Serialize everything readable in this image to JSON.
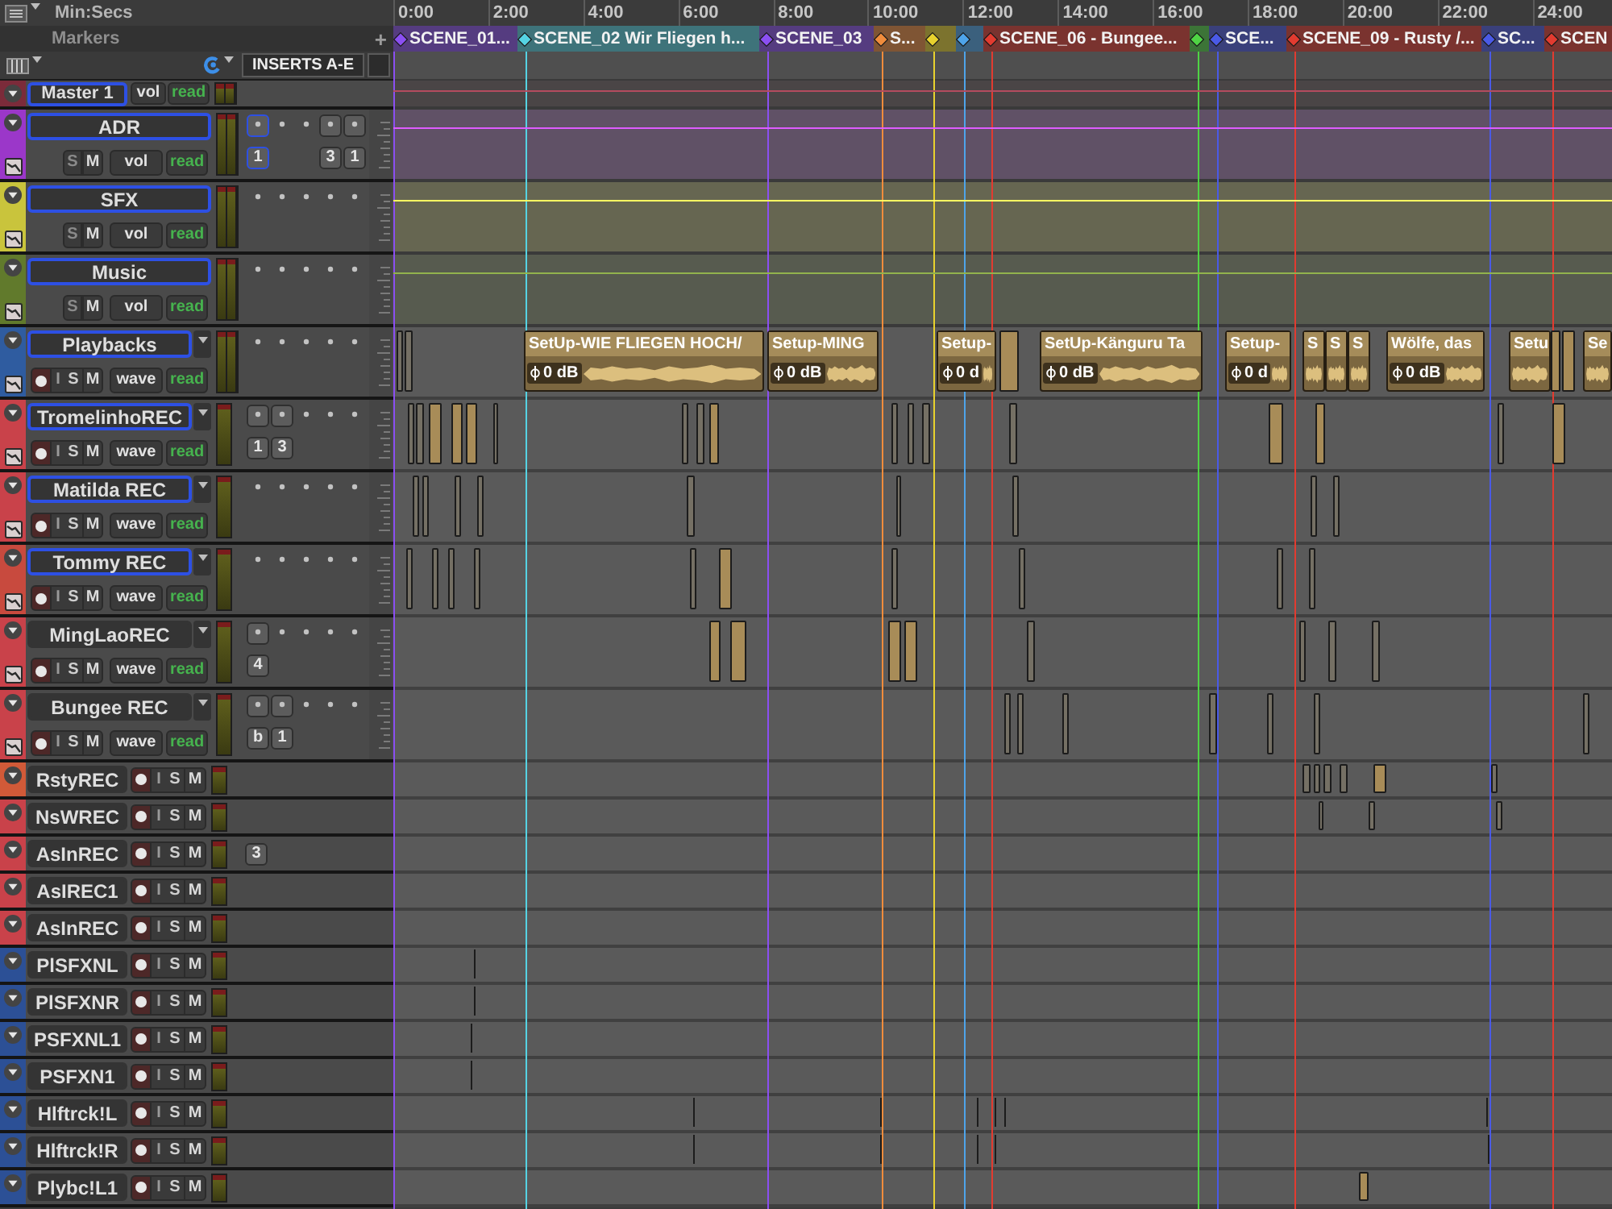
{
  "ruler": {
    "label": "Min:Secs",
    "ticks": [
      "0:00",
      "2:00",
      "4:00",
      "6:00",
      "8:00",
      "10:00",
      "12:00",
      "14:00",
      "16:00",
      "18:00",
      "20:00",
      "22:00",
      "24:00"
    ]
  },
  "markers": {
    "label": "Markers",
    "add": "+",
    "items": [
      {
        "name": "SCENE_01...",
        "color": "#8b4ff2"
      },
      {
        "name": "SCENE_02 Wir Fliegen h...",
        "color": "#55d3e3"
      },
      {
        "name": "SCENE_03",
        "color": "#8b4ff2"
      },
      {
        "name": "S...",
        "color": "#f08c3c"
      },
      {
        "color": "#e8d22e"
      },
      {
        "color": "#4ea4ea"
      },
      {
        "name": "SCENE_06 - Bungee...",
        "color": "#e23b30"
      },
      {
        "color": "#4fd444"
      },
      {
        "name": "SCE...",
        "color": "#4a5ae6"
      },
      {
        "name": "SCENE_09 - Rusty /...",
        "color": "#e23b30"
      },
      {
        "name": "SC...",
        "color": "#4a5ae6"
      },
      {
        "name": "SCEN",
        "color": "#e23b30"
      }
    ]
  },
  "track_list": {
    "column": "INSERTS A-E"
  },
  "tracks": [
    {
      "name": "Master 1",
      "color": "#7b2b3a",
      "kind": "master",
      "selected": true,
      "stereo": true,
      "view": "vol",
      "automation": "read"
    },
    {
      "name": "ADR",
      "color": "#9b37c9",
      "kind": "aux",
      "selected": true,
      "stereo": true,
      "solo": "S",
      "mute": "M",
      "view": "vol",
      "automation": "read",
      "inserts": [
        {
          "assigned": true,
          "selected": true,
          "label": "1"
        },
        {
          "assigned": false,
          "selected": false
        },
        {
          "assigned": false,
          "selected": false
        },
        {
          "assigned": true,
          "selected": false,
          "label": "3"
        },
        {
          "assigned": true,
          "selected": false,
          "label": "1"
        }
      ]
    },
    {
      "name": "SFX",
      "color": "#c9c43c",
      "kind": "aux",
      "selected": true,
      "stereo": true,
      "solo": "S",
      "mute": "M",
      "view": "vol",
      "automation": "read",
      "inserts": [
        {
          "assigned": false,
          "selected": false
        },
        {
          "assigned": false,
          "selected": false
        },
        {
          "assigned": false,
          "selected": false
        },
        {
          "assigned": false,
          "selected": false
        },
        {
          "assigned": false,
          "selected": false
        }
      ]
    },
    {
      "name": "Music",
      "color": "#617a2c",
      "kind": "aux",
      "selected": true,
      "stereo": true,
      "solo": "S",
      "mute": "M",
      "view": "vol",
      "automation": "read",
      "inserts": [
        {
          "assigned": false,
          "selected": false
        },
        {
          "assigned": false,
          "selected": false
        },
        {
          "assigned": false,
          "selected": false
        },
        {
          "assigned": false,
          "selected": false
        },
        {
          "assigned": false,
          "selected": false
        }
      ]
    },
    {
      "name": "Playbacks",
      "color": "#2f5ca0",
      "kind": "audio",
      "selected": true,
      "stereo": true,
      "input": "I",
      "solo": "S",
      "mute": "M",
      "view": "wave",
      "automation": "read",
      "inserts": [
        {
          "assigned": false,
          "selected": false
        },
        {
          "assigned": false,
          "selected": false
        },
        {
          "assigned": false,
          "selected": false
        },
        {
          "assigned": false,
          "selected": false
        },
        {
          "assigned": false,
          "selected": false
        }
      ],
      "clips": [
        {
          "name": "SetUp-WIE FLIEGEN HOCH/",
          "gain": "0 dB"
        },
        {
          "name": "Setup-MING",
          "gain": "0 dB"
        },
        {
          "name": "Setup-",
          "gain": "0 d"
        },
        {
          "name": "SetUp-Känguru Ta",
          "gain": "0 dB"
        },
        {
          "name": "Setup-",
          "gain": "0 d"
        },
        {
          "name": "S"
        },
        {
          "name": "S"
        },
        {
          "name": "S"
        },
        {
          "name": "Wölfe, das",
          "gain": "0 dB"
        },
        {
          "name": "Setu"
        },
        {
          "name": "Se"
        }
      ]
    },
    {
      "name": "TromelinhoREC",
      "color": "#c9424a",
      "kind": "audio",
      "selected": true,
      "stereo": false,
      "input": "I",
      "solo": "S",
      "mute": "M",
      "view": "wave",
      "automation": "read",
      "inserts": [
        {
          "assigned": true,
          "selected": false,
          "label": "1"
        },
        {
          "assigned": true,
          "selected": false,
          "label": "3"
        },
        {
          "assigned": false,
          "selected": false
        },
        {
          "assigned": false,
          "selected": false
        },
        {
          "assigned": false,
          "selected": false
        }
      ]
    },
    {
      "name": "Matilda REC",
      "color": "#c9424a",
      "kind": "audio",
      "selected": true,
      "stereo": false,
      "input": "I",
      "solo": "S",
      "mute": "M",
      "view": "wave",
      "automation": "read",
      "inserts": [
        {
          "assigned": false,
          "selected": false
        },
        {
          "assigned": false,
          "selected": false
        },
        {
          "assigned": false,
          "selected": false
        },
        {
          "assigned": false,
          "selected": false
        },
        {
          "assigned": false,
          "selected": false
        }
      ]
    },
    {
      "name": "Tommy REC",
      "color": "#c84a3e",
      "kind": "audio",
      "selected": true,
      "stereo": false,
      "input": "I",
      "solo": "S",
      "mute": "M",
      "view": "wave",
      "automation": "read",
      "inserts": [
        {
          "assigned": false,
          "selected": false
        },
        {
          "assigned": false,
          "selected": false
        },
        {
          "assigned": false,
          "selected": false
        },
        {
          "assigned": false,
          "selected": false
        },
        {
          "assigned": false,
          "selected": false
        }
      ]
    },
    {
      "name": "MingLaoREC",
      "color": "#c9424a",
      "kind": "audio",
      "selected": false,
      "stereo": false,
      "input": "I",
      "solo": "S",
      "mute": "M",
      "view": "wave",
      "automation": "read",
      "inserts": [
        {
          "assigned": true,
          "selected": false,
          "label": "4"
        },
        {
          "assigned": false,
          "selected": false
        },
        {
          "assigned": false,
          "selected": false
        },
        {
          "assigned": false,
          "selected": false
        },
        {
          "assigned": false,
          "selected": false
        }
      ]
    },
    {
      "name": "Bungee REC",
      "color": "#c9424a",
      "kind": "audio",
      "selected": false,
      "stereo": false,
      "input": "I",
      "solo": "S",
      "mute": "M",
      "view": "wave",
      "automation": "read",
      "inserts": [
        {
          "assigned": true,
          "selected": false,
          "label": "b"
        },
        {
          "assigned": true,
          "selected": false,
          "label": "1"
        },
        {
          "assigned": false,
          "selected": false
        },
        {
          "assigned": false,
          "selected": false
        },
        {
          "assigned": false,
          "selected": false
        }
      ]
    },
    {
      "name": "RstyREC",
      "color": "#d15a38",
      "kind": "audio_small",
      "selected": false,
      "stereo": false,
      "input": "I",
      "solo": "S",
      "mute": "M"
    },
    {
      "name": "NsWREC",
      "color": "#c9424a",
      "kind": "audio_small",
      "selected": false,
      "stereo": false,
      "input": "I",
      "solo": "S",
      "mute": "M"
    },
    {
      "name": "AsInREC",
      "color": "#c9424a",
      "kind": "audio_small",
      "selected": false,
      "stereo": false,
      "input": "I",
      "solo": "S",
      "mute": "M",
      "inserts": [
        {
          "selected": false,
          "label": "3"
        }
      ]
    },
    {
      "name": "AsIREC1",
      "color": "#c9424a",
      "kind": "audio_small",
      "selected": false,
      "stereo": false,
      "input": "I",
      "solo": "S",
      "mute": "M"
    },
    {
      "name": "AsInREC",
      "color": "#c9424a",
      "kind": "audio_small",
      "selected": false,
      "stereo": false,
      "input": "I",
      "solo": "S",
      "mute": "M"
    },
    {
      "name": "PlSFXNL",
      "color": "#2c5096",
      "kind": "audio_small",
      "selected": false,
      "stereo": false,
      "input": "I",
      "solo": "S",
      "mute": "M"
    },
    {
      "name": "PlSFXNR",
      "color": "#2c5096",
      "kind": "audio_small",
      "selected": false,
      "stereo": false,
      "input": "I",
      "solo": "S",
      "mute": "M"
    },
    {
      "name": "PSFXNL1",
      "color": "#2c5096",
      "kind": "audio_small",
      "selected": false,
      "stereo": false,
      "input": "I",
      "solo": "S",
      "mute": "M"
    },
    {
      "name": "PSFXN1",
      "color": "#2c5096",
      "kind": "audio_small",
      "selected": false,
      "stereo": false,
      "input": "I",
      "solo": "S",
      "mute": "M"
    },
    {
      "name": "Hlftrck!L",
      "color": "#2c5096",
      "kind": "audio_small",
      "selected": false,
      "stereo": false,
      "input": "I",
      "solo": "S",
      "mute": "M"
    },
    {
      "name": "Hlftrck!R",
      "color": "#2c5096",
      "kind": "audio_small",
      "selected": false,
      "stereo": false,
      "input": "I",
      "solo": "S",
      "mute": "M"
    },
    {
      "name": "Plybc!L1",
      "color": "#2c5096",
      "kind": "audio_small",
      "selected": false,
      "stereo": false,
      "input": "I",
      "solo": "S",
      "mute": "M"
    }
  ]
}
